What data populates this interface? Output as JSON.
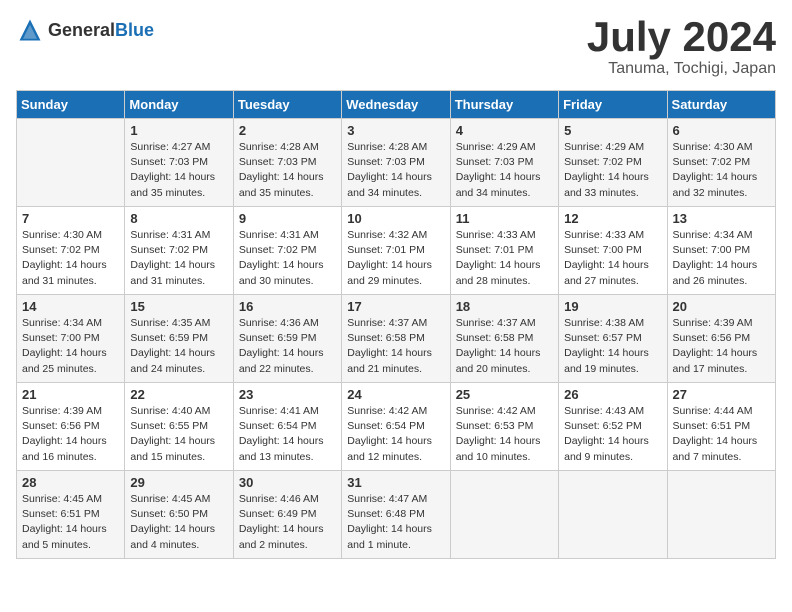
{
  "header": {
    "logo_general": "General",
    "logo_blue": "Blue",
    "month": "July 2024",
    "location": "Tanuma, Tochigi, Japan"
  },
  "days_of_week": [
    "Sunday",
    "Monday",
    "Tuesday",
    "Wednesday",
    "Thursday",
    "Friday",
    "Saturday"
  ],
  "weeks": [
    [
      {
        "day": "",
        "info": ""
      },
      {
        "day": "1",
        "info": "Sunrise: 4:27 AM\nSunset: 7:03 PM\nDaylight: 14 hours\nand 35 minutes."
      },
      {
        "day": "2",
        "info": "Sunrise: 4:28 AM\nSunset: 7:03 PM\nDaylight: 14 hours\nand 35 minutes."
      },
      {
        "day": "3",
        "info": "Sunrise: 4:28 AM\nSunset: 7:03 PM\nDaylight: 14 hours\nand 34 minutes."
      },
      {
        "day": "4",
        "info": "Sunrise: 4:29 AM\nSunset: 7:03 PM\nDaylight: 14 hours\nand 34 minutes."
      },
      {
        "day": "5",
        "info": "Sunrise: 4:29 AM\nSunset: 7:02 PM\nDaylight: 14 hours\nand 33 minutes."
      },
      {
        "day": "6",
        "info": "Sunrise: 4:30 AM\nSunset: 7:02 PM\nDaylight: 14 hours\nand 32 minutes."
      }
    ],
    [
      {
        "day": "7",
        "info": "Sunrise: 4:30 AM\nSunset: 7:02 PM\nDaylight: 14 hours\nand 31 minutes."
      },
      {
        "day": "8",
        "info": "Sunrise: 4:31 AM\nSunset: 7:02 PM\nDaylight: 14 hours\nand 31 minutes."
      },
      {
        "day": "9",
        "info": "Sunrise: 4:31 AM\nSunset: 7:02 PM\nDaylight: 14 hours\nand 30 minutes."
      },
      {
        "day": "10",
        "info": "Sunrise: 4:32 AM\nSunset: 7:01 PM\nDaylight: 14 hours\nand 29 minutes."
      },
      {
        "day": "11",
        "info": "Sunrise: 4:33 AM\nSunset: 7:01 PM\nDaylight: 14 hours\nand 28 minutes."
      },
      {
        "day": "12",
        "info": "Sunrise: 4:33 AM\nSunset: 7:00 PM\nDaylight: 14 hours\nand 27 minutes."
      },
      {
        "day": "13",
        "info": "Sunrise: 4:34 AM\nSunset: 7:00 PM\nDaylight: 14 hours\nand 26 minutes."
      }
    ],
    [
      {
        "day": "14",
        "info": "Sunrise: 4:34 AM\nSunset: 7:00 PM\nDaylight: 14 hours\nand 25 minutes."
      },
      {
        "day": "15",
        "info": "Sunrise: 4:35 AM\nSunset: 6:59 PM\nDaylight: 14 hours\nand 24 minutes."
      },
      {
        "day": "16",
        "info": "Sunrise: 4:36 AM\nSunset: 6:59 PM\nDaylight: 14 hours\nand 22 minutes."
      },
      {
        "day": "17",
        "info": "Sunrise: 4:37 AM\nSunset: 6:58 PM\nDaylight: 14 hours\nand 21 minutes."
      },
      {
        "day": "18",
        "info": "Sunrise: 4:37 AM\nSunset: 6:58 PM\nDaylight: 14 hours\nand 20 minutes."
      },
      {
        "day": "19",
        "info": "Sunrise: 4:38 AM\nSunset: 6:57 PM\nDaylight: 14 hours\nand 19 minutes."
      },
      {
        "day": "20",
        "info": "Sunrise: 4:39 AM\nSunset: 6:56 PM\nDaylight: 14 hours\nand 17 minutes."
      }
    ],
    [
      {
        "day": "21",
        "info": "Sunrise: 4:39 AM\nSunset: 6:56 PM\nDaylight: 14 hours\nand 16 minutes."
      },
      {
        "day": "22",
        "info": "Sunrise: 4:40 AM\nSunset: 6:55 PM\nDaylight: 14 hours\nand 15 minutes."
      },
      {
        "day": "23",
        "info": "Sunrise: 4:41 AM\nSunset: 6:54 PM\nDaylight: 14 hours\nand 13 minutes."
      },
      {
        "day": "24",
        "info": "Sunrise: 4:42 AM\nSunset: 6:54 PM\nDaylight: 14 hours\nand 12 minutes."
      },
      {
        "day": "25",
        "info": "Sunrise: 4:42 AM\nSunset: 6:53 PM\nDaylight: 14 hours\nand 10 minutes."
      },
      {
        "day": "26",
        "info": "Sunrise: 4:43 AM\nSunset: 6:52 PM\nDaylight: 14 hours\nand 9 minutes."
      },
      {
        "day": "27",
        "info": "Sunrise: 4:44 AM\nSunset: 6:51 PM\nDaylight: 14 hours\nand 7 minutes."
      }
    ],
    [
      {
        "day": "28",
        "info": "Sunrise: 4:45 AM\nSunset: 6:51 PM\nDaylight: 14 hours\nand 5 minutes."
      },
      {
        "day": "29",
        "info": "Sunrise: 4:45 AM\nSunset: 6:50 PM\nDaylight: 14 hours\nand 4 minutes."
      },
      {
        "day": "30",
        "info": "Sunrise: 4:46 AM\nSunset: 6:49 PM\nDaylight: 14 hours\nand 2 minutes."
      },
      {
        "day": "31",
        "info": "Sunrise: 4:47 AM\nSunset: 6:48 PM\nDaylight: 14 hours\nand 1 minute."
      },
      {
        "day": "",
        "info": ""
      },
      {
        "day": "",
        "info": ""
      },
      {
        "day": "",
        "info": ""
      }
    ]
  ]
}
